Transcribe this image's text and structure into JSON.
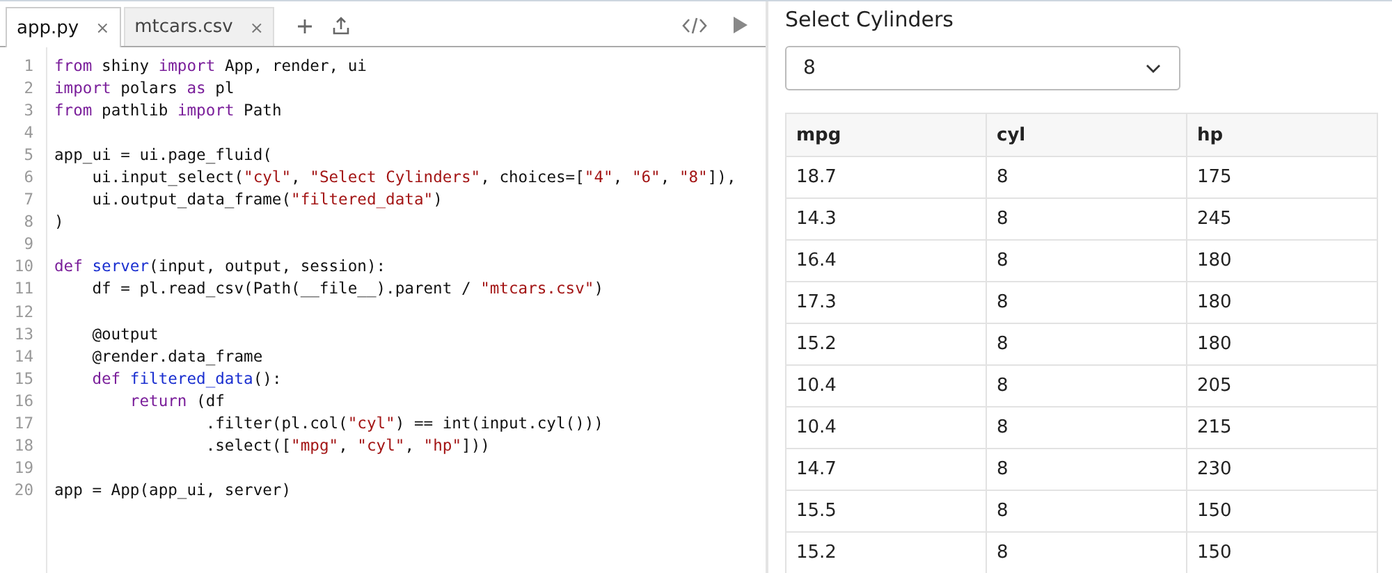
{
  "editor": {
    "tabs": [
      {
        "label": "app.py",
        "close": "×",
        "selected": true
      },
      {
        "label": "mtcars.csv",
        "close": "×",
        "selected": false
      }
    ],
    "lines": [
      {
        "number": "1",
        "tokens": [
          {
            "kind": "kw",
            "t": "from"
          },
          {
            "kind": "plain",
            "t": " shiny "
          },
          {
            "kind": "kw",
            "t": "import"
          },
          {
            "kind": "plain",
            "t": " App, render, ui"
          }
        ]
      },
      {
        "number": "2",
        "tokens": [
          {
            "kind": "kw",
            "t": "import"
          },
          {
            "kind": "plain",
            "t": " polars "
          },
          {
            "kind": "kw",
            "t": "as"
          },
          {
            "kind": "plain",
            "t": " pl"
          }
        ]
      },
      {
        "number": "3",
        "tokens": [
          {
            "kind": "kw",
            "t": "from"
          },
          {
            "kind": "plain",
            "t": " pathlib "
          },
          {
            "kind": "kw",
            "t": "import"
          },
          {
            "kind": "plain",
            "t": " Path"
          }
        ]
      },
      {
        "number": "4"
      },
      {
        "number": "5",
        "tokens": [
          {
            "kind": "plain",
            "t": "app_ui = ui.page_fluid("
          }
        ]
      },
      {
        "number": "6",
        "tokens": [
          {
            "kind": "plain",
            "t": "    ui.input_select("
          },
          {
            "kind": "str",
            "t": "\"cyl\""
          },
          {
            "kind": "plain",
            "t": ", "
          },
          {
            "kind": "str",
            "t": "\"Select Cylinders\""
          },
          {
            "kind": "plain",
            "t": ", choices=["
          },
          {
            "kind": "str",
            "t": "\"4\""
          },
          {
            "kind": "plain",
            "t": ", "
          },
          {
            "kind": "str",
            "t": "\"6\""
          },
          {
            "kind": "plain",
            "t": ", "
          },
          {
            "kind": "str",
            "t": "\"8\""
          },
          {
            "kind": "plain",
            "t": "]),"
          }
        ]
      },
      {
        "number": "7",
        "tokens": [
          {
            "kind": "plain",
            "t": "    ui.output_data_frame("
          },
          {
            "kind": "str",
            "t": "\"filtered_data\""
          },
          {
            "kind": "plain",
            "t": ")"
          }
        ]
      },
      {
        "number": "8",
        "tokens": [
          {
            "kind": "plain",
            "t": ")"
          }
        ]
      },
      {
        "number": "9"
      },
      {
        "number": "10",
        "tokens": [
          {
            "kind": "kw",
            "t": "def "
          },
          {
            "kind": "fn",
            "t": "server"
          },
          {
            "kind": "plain",
            "t": "(input, output, session):"
          }
        ]
      },
      {
        "number": "11",
        "tokens": [
          {
            "kind": "plain",
            "t": "    df = pl.read_csv(Path(__file__).parent / "
          },
          {
            "kind": "str",
            "t": "\"mtcars.csv\""
          },
          {
            "kind": "plain",
            "t": ")"
          }
        ]
      },
      {
        "number": "12"
      },
      {
        "number": "13",
        "tokens": [
          {
            "kind": "plain",
            "t": "    @output"
          }
        ]
      },
      {
        "number": "14",
        "tokens": [
          {
            "kind": "plain",
            "t": "    @render.data_frame"
          }
        ]
      },
      {
        "number": "15",
        "tokens": [
          {
            "kind": "kw",
            "t": "    def "
          },
          {
            "kind": "fn",
            "t": "filtered_data"
          },
          {
            "kind": "plain",
            "t": "():"
          }
        ]
      },
      {
        "number": "16",
        "tokens": [
          {
            "kind": "kw",
            "t": "        return"
          },
          {
            "kind": "plain",
            "t": " (df"
          }
        ]
      },
      {
        "number": "17",
        "tokens": [
          {
            "kind": "plain",
            "t": "                .filter(pl.col("
          },
          {
            "kind": "str",
            "t": "\"cyl\""
          },
          {
            "kind": "plain",
            "t": ") == int(input.cyl()))"
          }
        ]
      },
      {
        "number": "18",
        "tokens": [
          {
            "kind": "plain",
            "t": "                .select(["
          },
          {
            "kind": "str",
            "t": "\"mpg\""
          },
          {
            "kind": "plain",
            "t": ", "
          },
          {
            "kind": "str",
            "t": "\"cyl\""
          },
          {
            "kind": "plain",
            "t": ", "
          },
          {
            "kind": "str",
            "t": "\"hp\""
          },
          {
            "kind": "plain",
            "t": "]))"
          }
        ]
      },
      {
        "number": "19"
      },
      {
        "number": "20",
        "tokens": [
          {
            "kind": "plain",
            "t": "app = App(app_ui, server)"
          }
        ]
      }
    ]
  },
  "preview": {
    "select": {
      "label": "Select Cylinders",
      "value": "8"
    },
    "table": {
      "columns": [
        "mpg",
        "cyl",
        "hp"
      ],
      "rows": [
        [
          "18.7",
          "8",
          "175"
        ],
        [
          "14.3",
          "8",
          "245"
        ],
        [
          "16.4",
          "8",
          "180"
        ],
        [
          "17.3",
          "8",
          "180"
        ],
        [
          "15.2",
          "8",
          "180"
        ],
        [
          "10.4",
          "8",
          "205"
        ],
        [
          "10.4",
          "8",
          "215"
        ],
        [
          "14.7",
          "8",
          "230"
        ],
        [
          "15.5",
          "8",
          "150"
        ],
        [
          "15.2",
          "8",
          "150"
        ]
      ]
    }
  }
}
